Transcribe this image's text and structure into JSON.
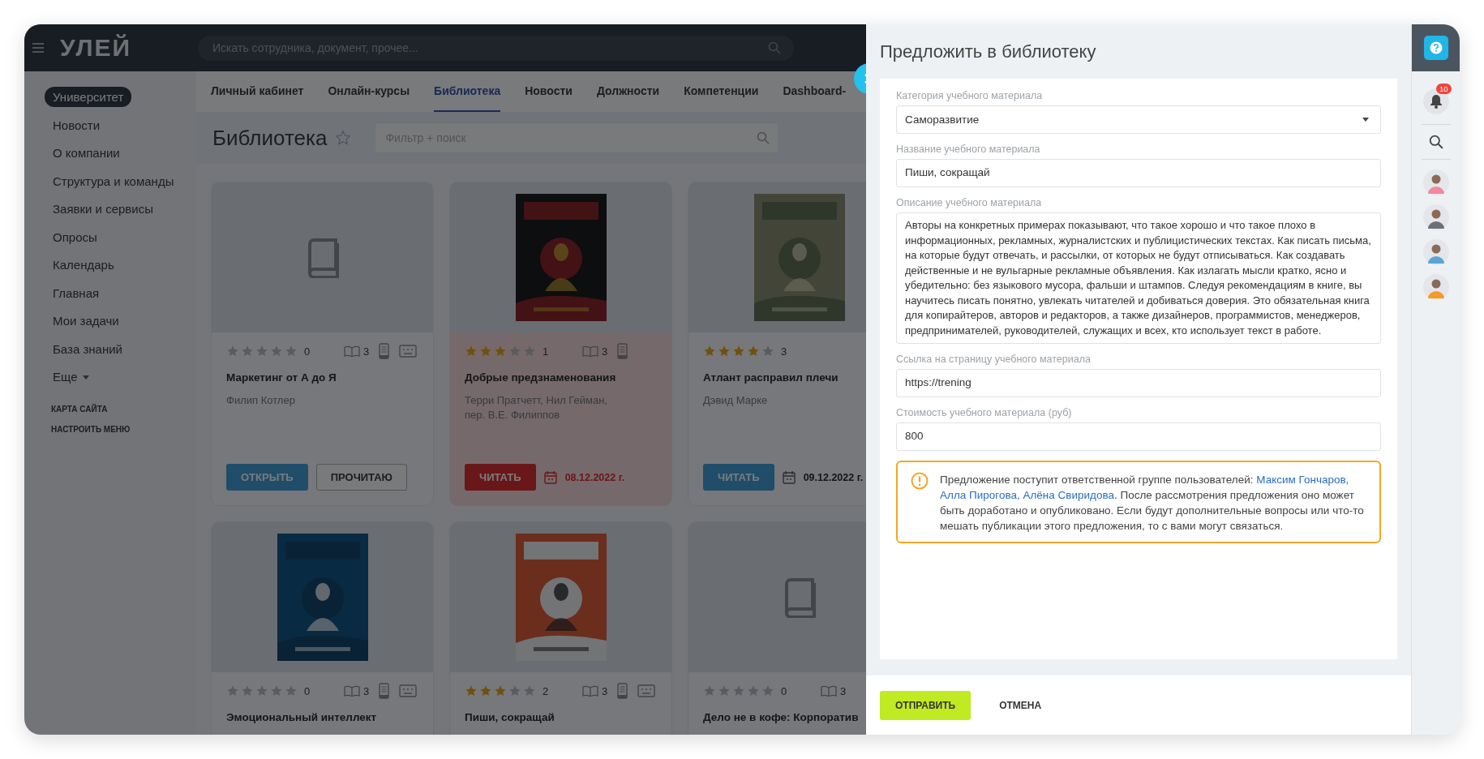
{
  "header": {
    "logo": "УЛЕЙ",
    "search": {
      "placeholder": "Искать сотрудника, документ, прочее..."
    }
  },
  "sidebar": {
    "items": [
      {
        "label": "Университет",
        "selected": true,
        "has_menu": false
      },
      {
        "label": "Новости",
        "selected": false,
        "has_menu": false
      },
      {
        "label": "О компании",
        "selected": false,
        "has_menu": false
      },
      {
        "label": "Структура и команды",
        "selected": false,
        "has_menu": false
      },
      {
        "label": "Заявки и сервисы",
        "selected": false,
        "has_menu": false
      },
      {
        "label": "Опросы",
        "selected": false,
        "has_menu": false
      },
      {
        "label": "Календарь",
        "selected": false,
        "has_menu": false
      },
      {
        "label": "Главная",
        "selected": false,
        "has_menu": false
      },
      {
        "label": "Мои задачи",
        "selected": false,
        "has_menu": false
      },
      {
        "label": "База знаний",
        "selected": false,
        "has_menu": false
      },
      {
        "label": "Еще",
        "selected": false,
        "has_menu": true
      }
    ],
    "links": [
      "КАРТА САЙТА",
      "НАСТРОИТЬ МЕНЮ"
    ]
  },
  "tabs": [
    {
      "label": "Личный кабинет",
      "selected": false
    },
    {
      "label": "Онлайн-курсы",
      "selected": false
    },
    {
      "label": "Библиотека",
      "selected": true
    },
    {
      "label": "Новости",
      "selected": false
    },
    {
      "label": "Должности",
      "selected": false
    },
    {
      "label": "Компетенции",
      "selected": false
    },
    {
      "label": "Dashboard-",
      "selected": false
    }
  ],
  "page": {
    "title": "Библиотека",
    "favorite": false,
    "filter": {
      "placeholder": "Фильтр + поиск"
    }
  },
  "cards": [
    {
      "cover": {
        "kind": "placeholder"
      },
      "stars": 0,
      "rating_count": "0",
      "formats": [
        {
          "kind": "book",
          "count": "3"
        },
        {
          "kind": "ereader"
        },
        {
          "kind": "audio"
        }
      ],
      "title": "Маркетинг от А до Я",
      "author": "Филип Котлер",
      "buttons": [
        {
          "label": "ОТКРЫТЬ",
          "kind": "primary"
        },
        {
          "label": "ПРОЧИТАЮ",
          "kind": "outline"
        }
      ],
      "overdue": false
    },
    {
      "cover": {
        "kind": "picture"
      },
      "stars": 3,
      "rating_count": "1",
      "formats": [
        {
          "kind": "book",
          "count": "3"
        },
        {
          "kind": "ereader"
        }
      ],
      "title": "Добрые предзнаменования",
      "author": "Терри Пратчетт, Нил Гейман, пер. В.Е. Филиппов",
      "buttons": [
        {
          "label": "ЧИТАТЬ",
          "kind": "danger"
        }
      ],
      "date": "08.12.2022 г.",
      "overdue": true
    },
    {
      "cover": {
        "kind": "picture"
      },
      "stars": 4,
      "rating_count": "3",
      "title": "Атлант расправил плечи",
      "author": "Дэвид Марке",
      "buttons": [
        {
          "label": "ЧИТАТЬ",
          "kind": "primary"
        }
      ],
      "date": "09.12.2022 г.",
      "overdue": false
    },
    {
      "cover": {
        "kind": "picture"
      },
      "stars": 0,
      "rating_count": "0",
      "formats": [
        {
          "kind": "book",
          "count": "3"
        },
        {
          "kind": "ereader"
        },
        {
          "kind": "audio"
        }
      ],
      "title": "Эмоциональный интеллект",
      "overdue": false
    },
    {
      "cover": {
        "kind": "picture"
      },
      "stars": 3,
      "rating_count": "2",
      "formats": [
        {
          "kind": "book",
          "count": "3"
        },
        {
          "kind": "ereader"
        },
        {
          "kind": "audio"
        }
      ],
      "title": "Пиши, сокращай",
      "overdue": false
    },
    {
      "cover": {
        "kind": "placeholder"
      },
      "stars": 0,
      "rating_count": "0",
      "formats": [
        {
          "kind": "book",
          "count": "3"
        }
      ],
      "title": "Дело не в кофе: Корпоратив",
      "overdue": false
    }
  ],
  "panel": {
    "title": "Предложить в библиотеку",
    "fields": [
      {
        "label": "Категория учебного материала",
        "value": "Саморазвитие",
        "kind": "select"
      },
      {
        "label": "Название учебного материала",
        "value": "Пиши, сокращай",
        "kind": "text"
      },
      {
        "label": "Описание учебного материала",
        "value": "Авторы на конкретных примерах показывают, что такое хорошо и что такое плохо в информационных, рекламных, журналистских и публицистических текстах. Как писать письма, на которые будут отвечать, и рассылки, от которых не будут отписываться. Как создавать действенные и не вульгарные рекламные объявления. Как излагать мысли кратко, ясно и убедительно: без языкового мусора, фальши и штампов. Следуя рекомендациям в книге, вы научитесь писать понятно, увлекать читателей и добиваться доверия. Это обязательная книга для копирайтеров, авторов и редакторов, а также дизайнеров, программистов, менеджеров, предпринимателей, руководителей, служащих и всех, кто использует текст в работе.",
        "kind": "textarea"
      },
      {
        "label": "Ссылка на страницу учебного материала",
        "value": "https://trening",
        "kind": "text"
      },
      {
        "label": "Стоимость учебного материала (руб)",
        "value": "800",
        "kind": "text"
      }
    ],
    "notice": {
      "text_before": "Предложение поступит ответственной группе пользователей: ",
      "links": [
        "Максим Гончаров,",
        "Алла Пирогова,",
        "Алёна Свиридова"
      ],
      "text_after": ". После рассмотрения предложения оно может быть доработано и опубликовано. Если будут дополнительные вопросы или что-то мешать публикации этого предложения, то с вами могут связаться."
    },
    "buttons": [
      {
        "label": "ОТПРАВИТЬ",
        "kind": "primary"
      },
      {
        "label": "ОТМЕНА",
        "kind": "plain"
      }
    ]
  },
  "rail": {
    "notifications": "10",
    "users": [
      {
        "kind": "avatar"
      },
      {
        "kind": "avatar"
      },
      {
        "kind": "avatar"
      },
      {
        "kind": "avatar"
      }
    ]
  }
}
